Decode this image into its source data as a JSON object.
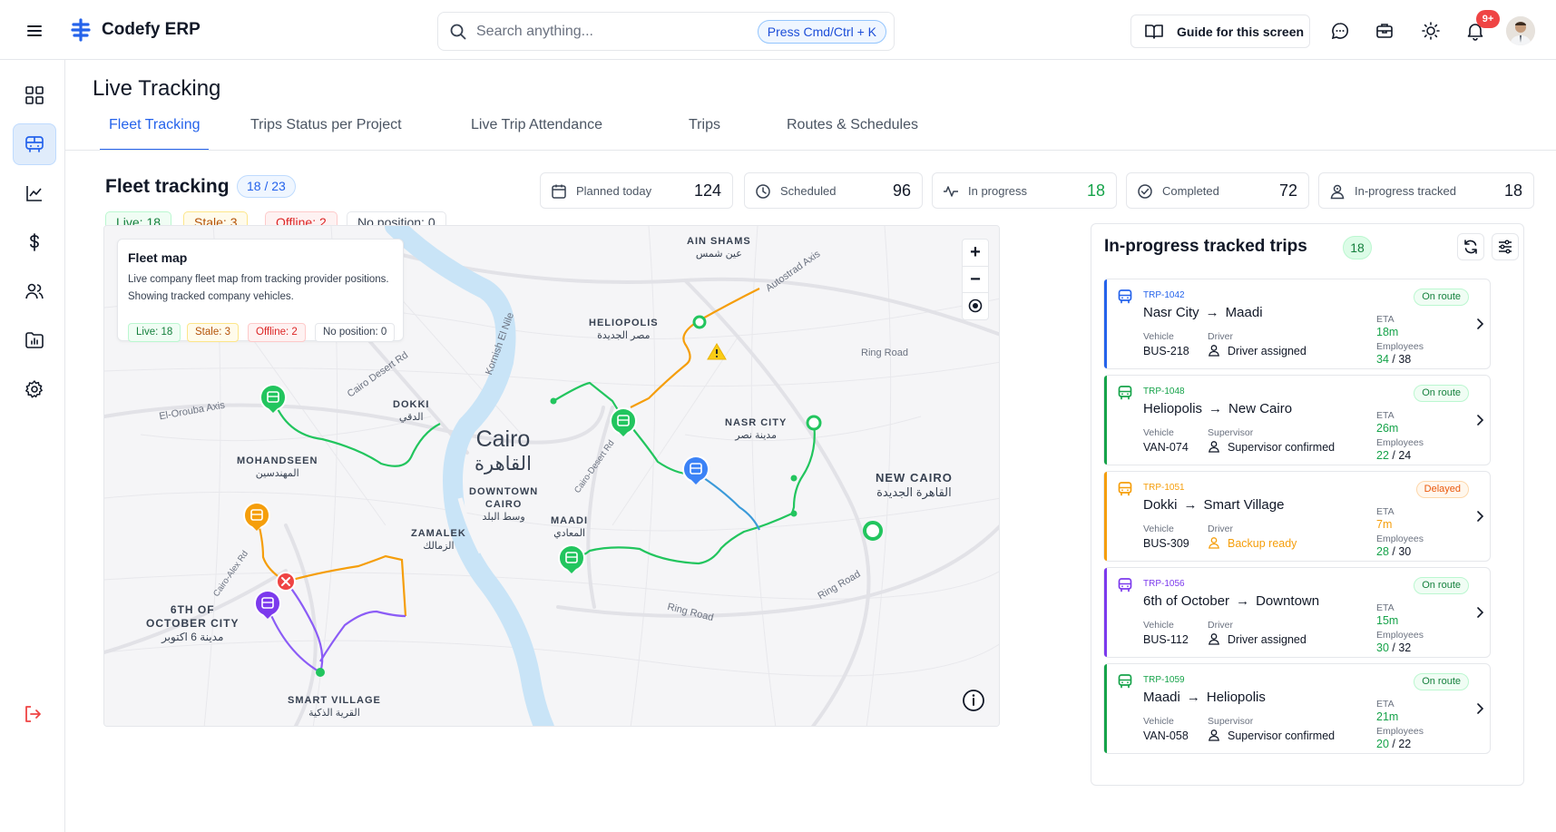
{
  "app": {
    "brand": "Codefy ERP",
    "notifications_badge": "9+"
  },
  "search": {
    "placeholder": "Search anything...",
    "shortcut": "Press Cmd/Ctrl + K"
  },
  "header": {
    "guide_label": "Guide for this screen"
  },
  "page": {
    "title": "Live Tracking"
  },
  "tabs": [
    {
      "label": "Fleet Tracking",
      "active": true
    },
    {
      "label": "Trips Status per Project"
    },
    {
      "label": "Live Trip Attendance"
    },
    {
      "label": "Trips"
    },
    {
      "label": "Routes & Schedules"
    }
  ],
  "fleet": {
    "title": "Fleet tracking",
    "count": "18 / 23",
    "chips": {
      "live": "Live: 18",
      "stale": "Stale: 3",
      "offline": "Offline: 2",
      "no_position": "No position: 0"
    }
  },
  "stats": [
    {
      "label": "Planned today",
      "value": "124",
      "icon": "calendar-icon"
    },
    {
      "label": "Scheduled",
      "value": "96",
      "icon": "clock-icon"
    },
    {
      "label": "In progress",
      "value": "18",
      "icon": "activity-icon",
      "color": "#16a34a"
    },
    {
      "label": "Completed",
      "value": "72",
      "icon": "check-circle-icon"
    },
    {
      "label": "In-progress tracked",
      "value": "18",
      "icon": "user-tracked-icon"
    }
  ],
  "map": {
    "legend_title": "Fleet map",
    "legend_desc1": "Live company fleet map from tracking provider positions.",
    "legend_desc2": "Showing tracked company vehicles.",
    "labels": {
      "ain_shams": "AIN SHAMS",
      "ain_shams_ar": "عين شمس",
      "heliopolis": "HELIOPOLIS",
      "heliopolis_ar": "مصر الجديدة",
      "dokki": "DOKKI",
      "dokki_ar": "الدقي",
      "nasr_city": "NASR CITY",
      "nasr_city_ar": "مدينة نصر",
      "cairo": "Cairo",
      "cairo_ar": "القاهرة",
      "mohandseen": "MOHANDSEEN",
      "mohandseen_ar": "المهندسين",
      "downtown": "DOWNTOWN",
      "downtown2": "CAIRO",
      "downtown_ar": "وسط البلد",
      "new_cairo": "NEW CAIRO",
      "new_cairo_ar": "القاهرة الجديدة",
      "maadi": "MAADI",
      "maadi_ar": "المعادي",
      "zamalek": "ZAMALEK",
      "zamalek_ar": "الزمالك",
      "october": "6TH OF",
      "october2": "OCTOBER CITY",
      "october_ar": "مدينة 6 اكتوبر",
      "smart_village": "SMART VILLAGE",
      "smart_village_ar": "القرية الذكية"
    },
    "roads": {
      "autostrad": "Autostrad Axis",
      "ring1": "Ring Road",
      "ring2": "Ring Road",
      "ring3": "Ring Road",
      "el_orouba": "El-Orouba Axis",
      "cairo_desert": "Cairo Desert Rd",
      "kornish": "Kornish El Nile",
      "cairo_desert2": "Cairo-Desert Rd",
      "cairo_alex": "Cairo-Alex Rd"
    }
  },
  "trips_panel": {
    "title": "In-progress tracked trips",
    "count": "18",
    "trips": [
      {
        "id": "TRP-1042",
        "from": "Nasr City",
        "to": "Maadi",
        "vehicle_label": "Vehicle",
        "vehicle": "BUS-218",
        "role_label": "Driver",
        "role_value": "Driver assigned",
        "status": "On route",
        "eta_label": "ETA",
        "eta": "18m",
        "emp_label": "Employees",
        "emp_on": "34",
        "emp_total": "/ 38",
        "color": "#2563eb"
      },
      {
        "id": "TRP-1048",
        "from": "Heliopolis",
        "to": "New Cairo",
        "vehicle_label": "Vehicle",
        "vehicle": "VAN-074",
        "role_label": "Supervisor",
        "role_value": "Supervisor confirmed",
        "status": "On route",
        "eta_label": "ETA",
        "eta": "26m",
        "emp_label": "Employees",
        "emp_on": "22",
        "emp_total": "/ 24",
        "color": "#16a34a"
      },
      {
        "id": "TRP-1051",
        "from": "Dokki",
        "to": "Smart Village",
        "vehicle_label": "Vehicle",
        "vehicle": "BUS-309",
        "role_label": "Driver",
        "role_value": "Backup ready",
        "status": "Delayed",
        "eta_label": "ETA",
        "eta": "7m",
        "emp_label": "Employees",
        "emp_on": "28",
        "emp_total": "/ 30",
        "color": "#f59e0b"
      },
      {
        "id": "TRP-1056",
        "from": "6th of October",
        "to": "Downtown",
        "vehicle_label": "Vehicle",
        "vehicle": "BUS-112",
        "role_label": "Driver",
        "role_value": "Driver assigned",
        "status": "On route",
        "eta_label": "ETA",
        "eta": "15m",
        "emp_label": "Employees",
        "emp_on": "30",
        "emp_total": "/ 32",
        "color": "#7c3aed"
      },
      {
        "id": "TRP-1059",
        "from": "Maadi",
        "to": "Heliopolis",
        "vehicle_label": "Vehicle",
        "vehicle": "VAN-058",
        "role_label": "Supervisor",
        "role_value": "Supervisor confirmed",
        "status": "On route",
        "eta_label": "ETA",
        "eta": "21m",
        "emp_label": "Employees",
        "emp_on": "20",
        "emp_total": "/ 22",
        "color": "#16a34a"
      }
    ]
  }
}
